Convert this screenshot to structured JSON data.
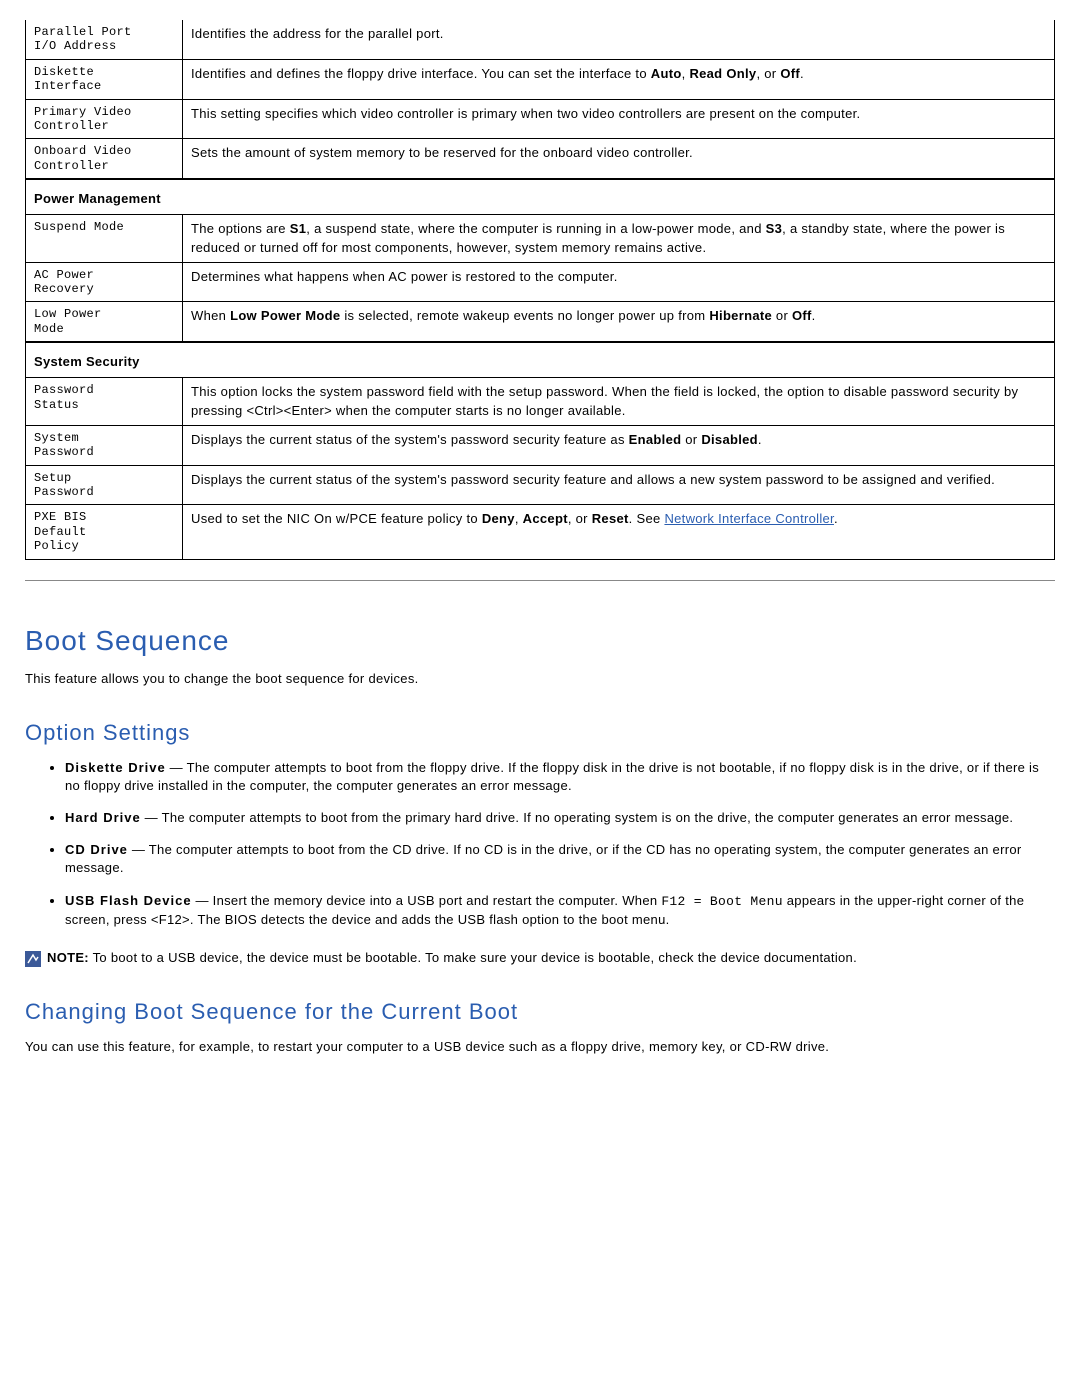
{
  "rows": [
    {
      "label": "Parallel Port\nI/O Address",
      "desc": "Identifies the address for the parallel port."
    },
    {
      "label": "Diskette\nInterface",
      "desc_html": "Identifies and defines the floppy drive interface. You can set the interface to <b>Auto</b>, <b>Read Only</b>, or <b>Off</b>."
    },
    {
      "label": "Primary Video\nController",
      "desc": "This setting specifies which video controller is primary when two video controllers are present on the computer."
    },
    {
      "label": "Onboard Video\nController",
      "desc": "Sets the amount of system memory to be reserved for the onboard video controller."
    }
  ],
  "pm_header": "Power Management",
  "pm_rows": [
    {
      "label": "Suspend Mode",
      "desc_html": "The options are <b>S1</b>, a suspend state, where the computer is running in a low-power mode, and <b>S3</b>, a standby state, where the power is reduced or turned off for most components, however, system memory remains active."
    },
    {
      "label": "AC Power\nRecovery",
      "desc": "Determines what happens when AC power is restored to the computer."
    },
    {
      "label": "Low Power\nMode",
      "desc_html": "When <b>Low Power Mode</b> is selected, remote wakeup events no longer power up from <b>Hibernate</b> or <b>Off</b>."
    }
  ],
  "ss_header": "System Security",
  "ss_rows": [
    {
      "label": "Password\nStatus",
      "desc": "This option locks the system password field with the setup password. When the field is locked, the option to disable password security by pressing <Ctrl><Enter> when the computer starts is no longer available."
    },
    {
      "label": "System\nPassword",
      "desc_html": "Displays the current status of the system's password security feature as <b>Enabled</b> or <b>Disabled</b>."
    },
    {
      "label": "Setup\nPassword",
      "desc": "Displays the current status of the system's password security feature and allows a new system password to be assigned and verified."
    },
    {
      "label": "PXE BIS\nDefault\nPolicy",
      "desc_html": "Used to set the NIC On w/PCE feature policy to <b>Deny</b>, <b>Accept</b>, or <b>Reset</b>. See <a class='link' data-interactable='true' data-name='link-nic'>Network Interface Controller</a>."
    }
  ],
  "boot_heading": "Boot Sequence",
  "boot_intro": "This feature allows you to change the boot sequence for devices.",
  "option_heading": "Option Settings",
  "options": [
    {
      "bold": "Diskette Drive",
      "text": " — The computer attempts to boot from the floppy drive. If the floppy disk in the drive is not bootable, if no floppy disk is in the drive, or if there is no floppy drive installed in the computer, the computer generates an error message."
    },
    {
      "bold": "Hard Drive",
      "text": " — The computer attempts to boot from the primary hard drive. If no operating system is on the drive, the computer generates an error message."
    },
    {
      "bold": "CD Drive",
      "text": " — The computer attempts to boot from the CD drive. If no CD is in the drive, or if the CD has no operating system, the computer generates an error message."
    },
    {
      "bold": "USB Flash Device",
      "html": " — Insert the memory device into a USB port and restart the computer. When <span class='mono'>F12 = Boot Menu</span> appears in the upper-right corner of the screen, press &lt;F12&gt;. The BIOS detects the device and adds the USB flash option to the boot menu."
    }
  ],
  "note_label": "NOTE:",
  "note_text": " To boot to a USB device, the device must be bootable. To make sure your device is bootable, check the device documentation.",
  "changing_heading": "Changing Boot Sequence for the Current Boot",
  "changing_text": "You can use this feature, for example, to restart your computer to a USB device such as a floppy drive, memory key, or CD-RW drive."
}
